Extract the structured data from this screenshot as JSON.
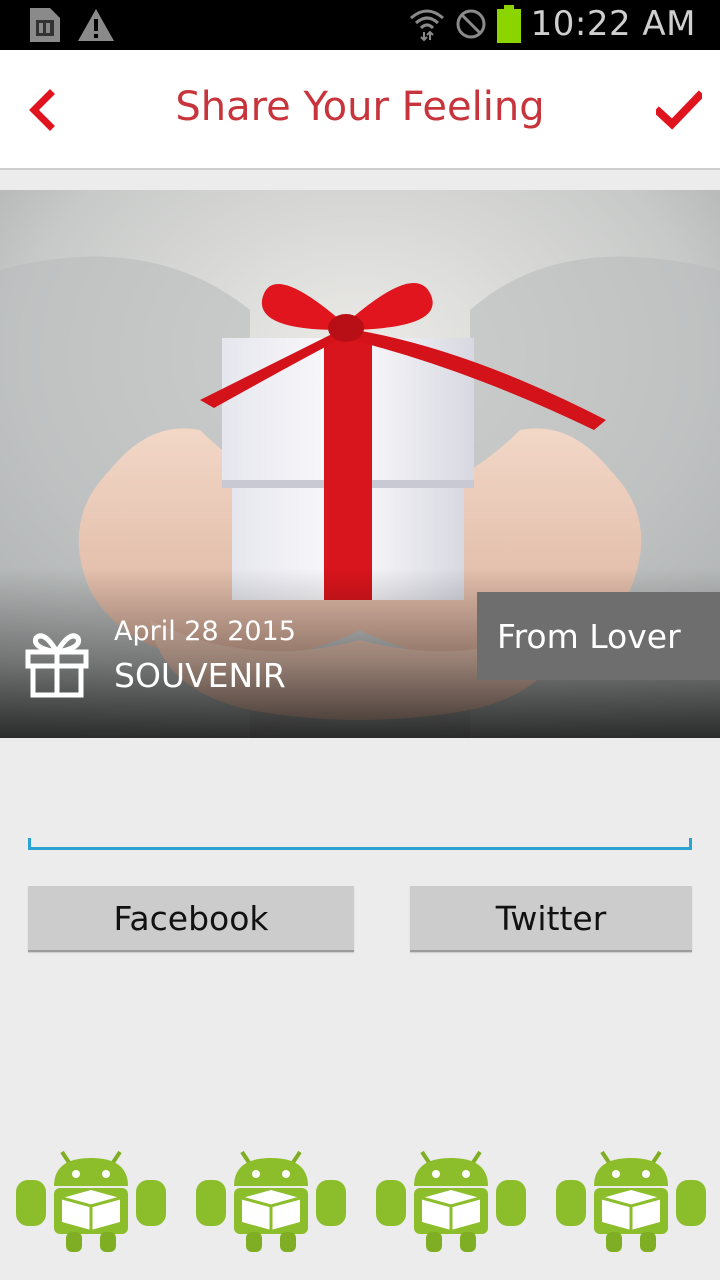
{
  "status_bar": {
    "time": "10:22 AM",
    "icons": [
      "sim-icon",
      "warning-icon",
      "wifi-icon",
      "no-signal-icon",
      "battery-icon"
    ]
  },
  "header": {
    "title": "Share Your Feeling",
    "back_icon": "chevron-left-icon",
    "confirm_icon": "checkmark-icon"
  },
  "card": {
    "date": "April 28 2015",
    "category": "SOUVENIR",
    "from_label": "From Lover",
    "icon": "gift-icon"
  },
  "message_input": {
    "value": "",
    "placeholder": ""
  },
  "share": {
    "facebook_label": "Facebook",
    "twitter_label": "Twitter"
  },
  "bottom_bar": {
    "icons": [
      "android-box-icon",
      "android-box-icon",
      "android-box-icon",
      "android-box-icon"
    ]
  },
  "colors": {
    "accent_red": "#c8343b",
    "input_underline": "#2aa3d4",
    "button_bg": "#cccccc",
    "tag_bg": "#6e6e6e",
    "android_green": "#8cbd2b"
  }
}
